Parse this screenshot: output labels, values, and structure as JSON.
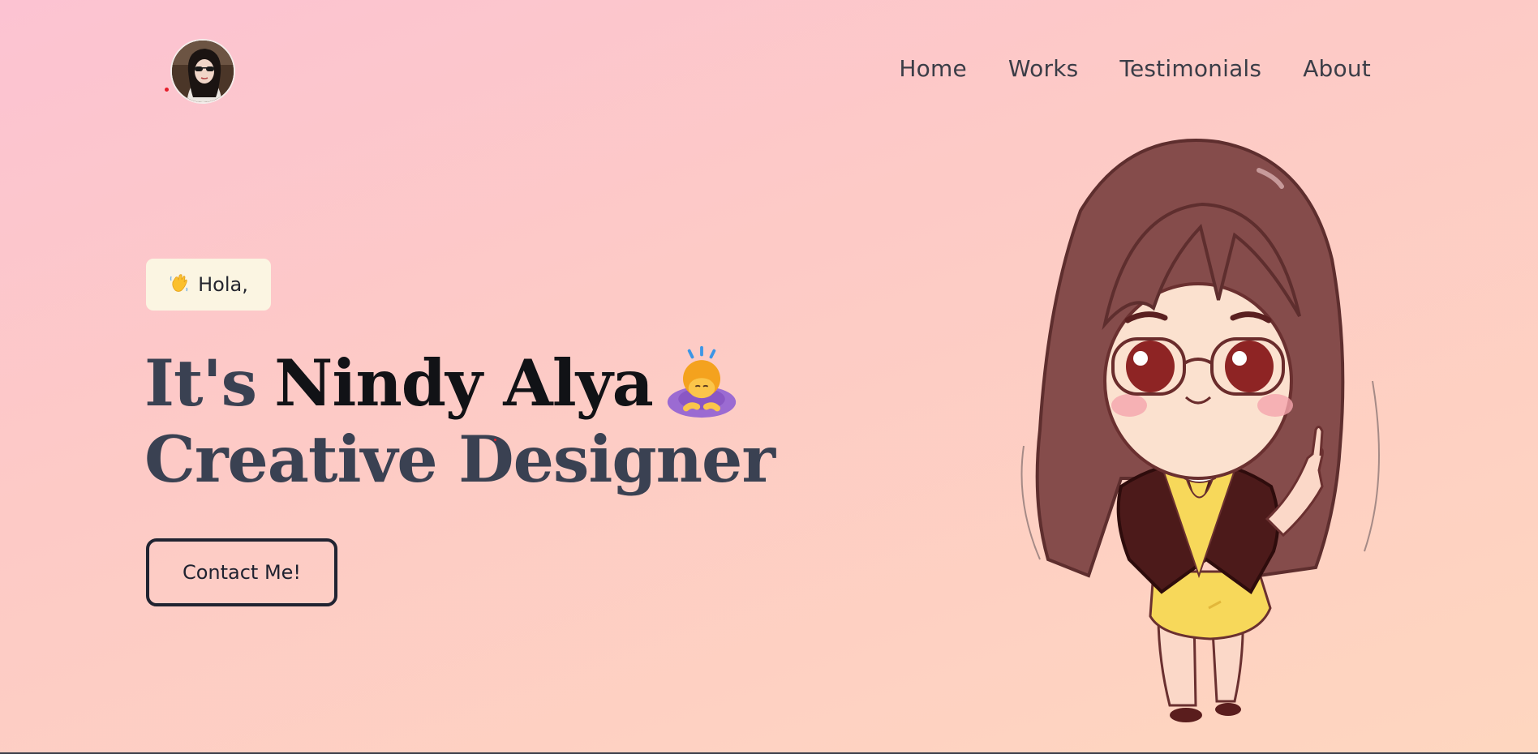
{
  "header": {
    "nav": [
      "Home",
      "Works",
      "Testimonials",
      "About"
    ]
  },
  "hero": {
    "greeting_icon": "waving-hand-icon",
    "greeting": "Hola,",
    "intro": "It's",
    "name": "Nindy Alya",
    "name_icon": "person-bowing-icon",
    "role": "Creative Designer",
    "cta": "Contact Me!"
  },
  "colors": {
    "background_start": "#fcc3d2",
    "background_end": "#fed6bf",
    "heading_dark": "#111216",
    "heading_muted": "#3a4152",
    "greeting_bg": "#fbf5e2",
    "button_border": "#202331"
  }
}
